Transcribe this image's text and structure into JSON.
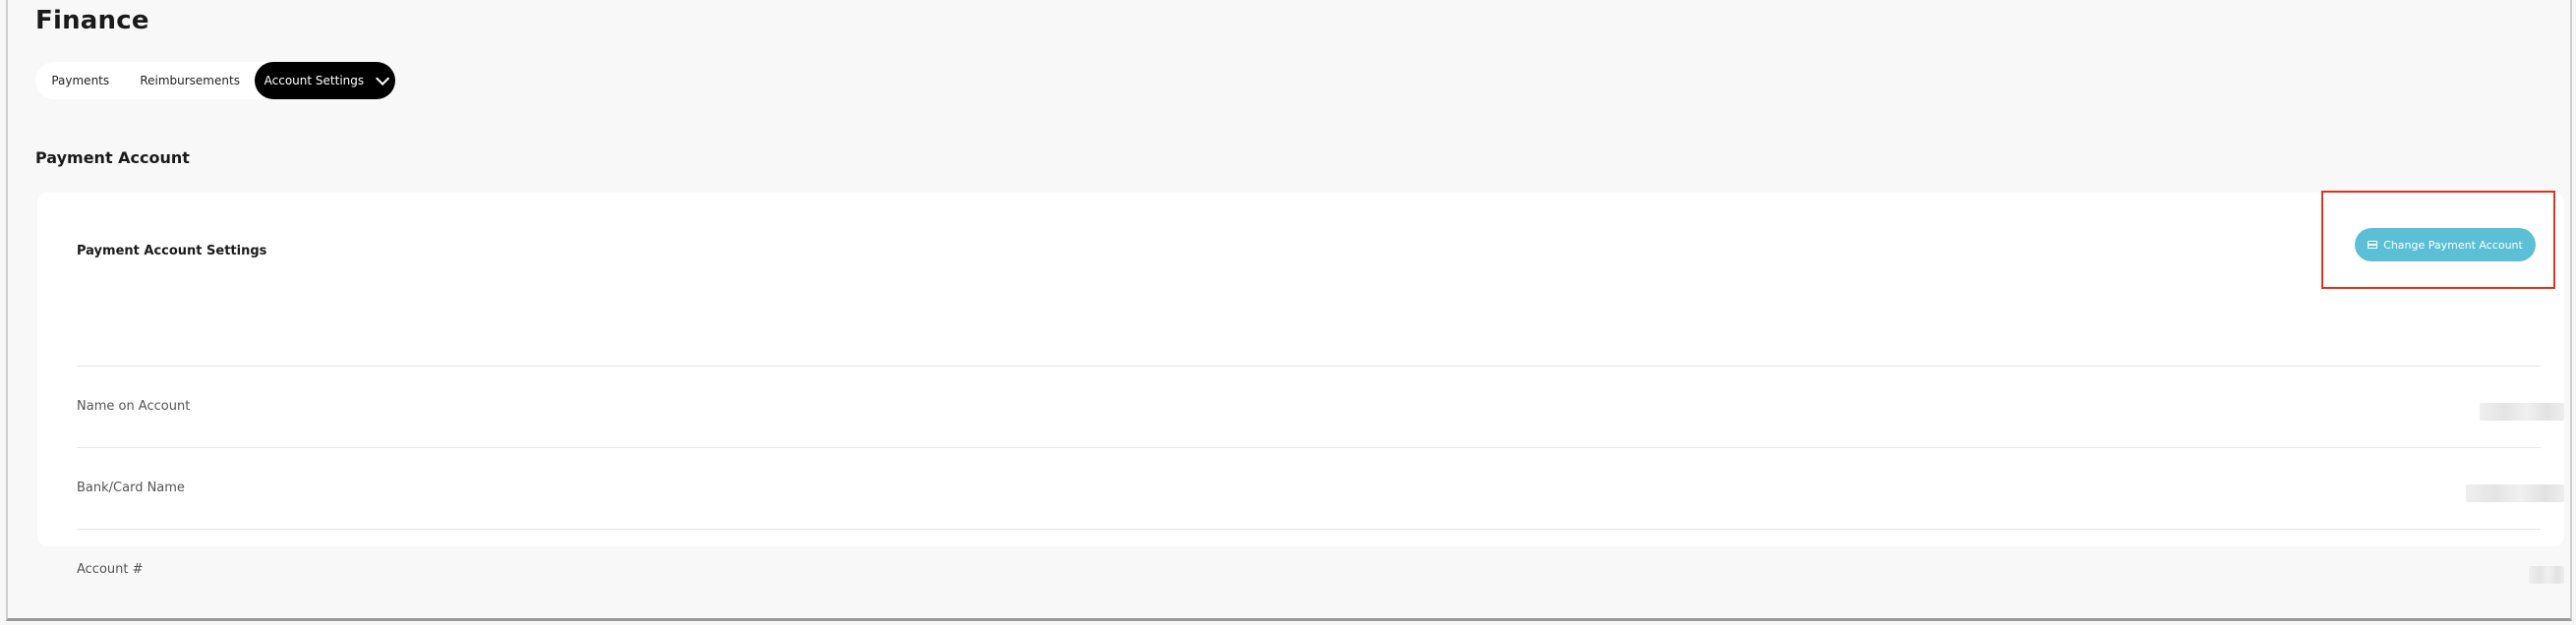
{
  "page": {
    "title": "Finance"
  },
  "tabs": [
    {
      "label": "Payments"
    },
    {
      "label": "Reimbursements"
    },
    {
      "label": "Account Settings",
      "active": true
    }
  ],
  "section": {
    "title": "Payment Account"
  },
  "card": {
    "title": "Payment Account Settings",
    "action_label": "Change Payment Account",
    "rows": [
      {
        "label": "Name on Account"
      },
      {
        "label": "Bank/Card Name"
      },
      {
        "label": "Account #"
      }
    ]
  },
  "colors": {
    "accent": "#5bc0d6",
    "active_tab": "#000000",
    "highlight": "#e0301e"
  },
  "icons": {
    "tab_dropdown": "chevron-down-icon",
    "change_account": "credit-card-icon"
  }
}
